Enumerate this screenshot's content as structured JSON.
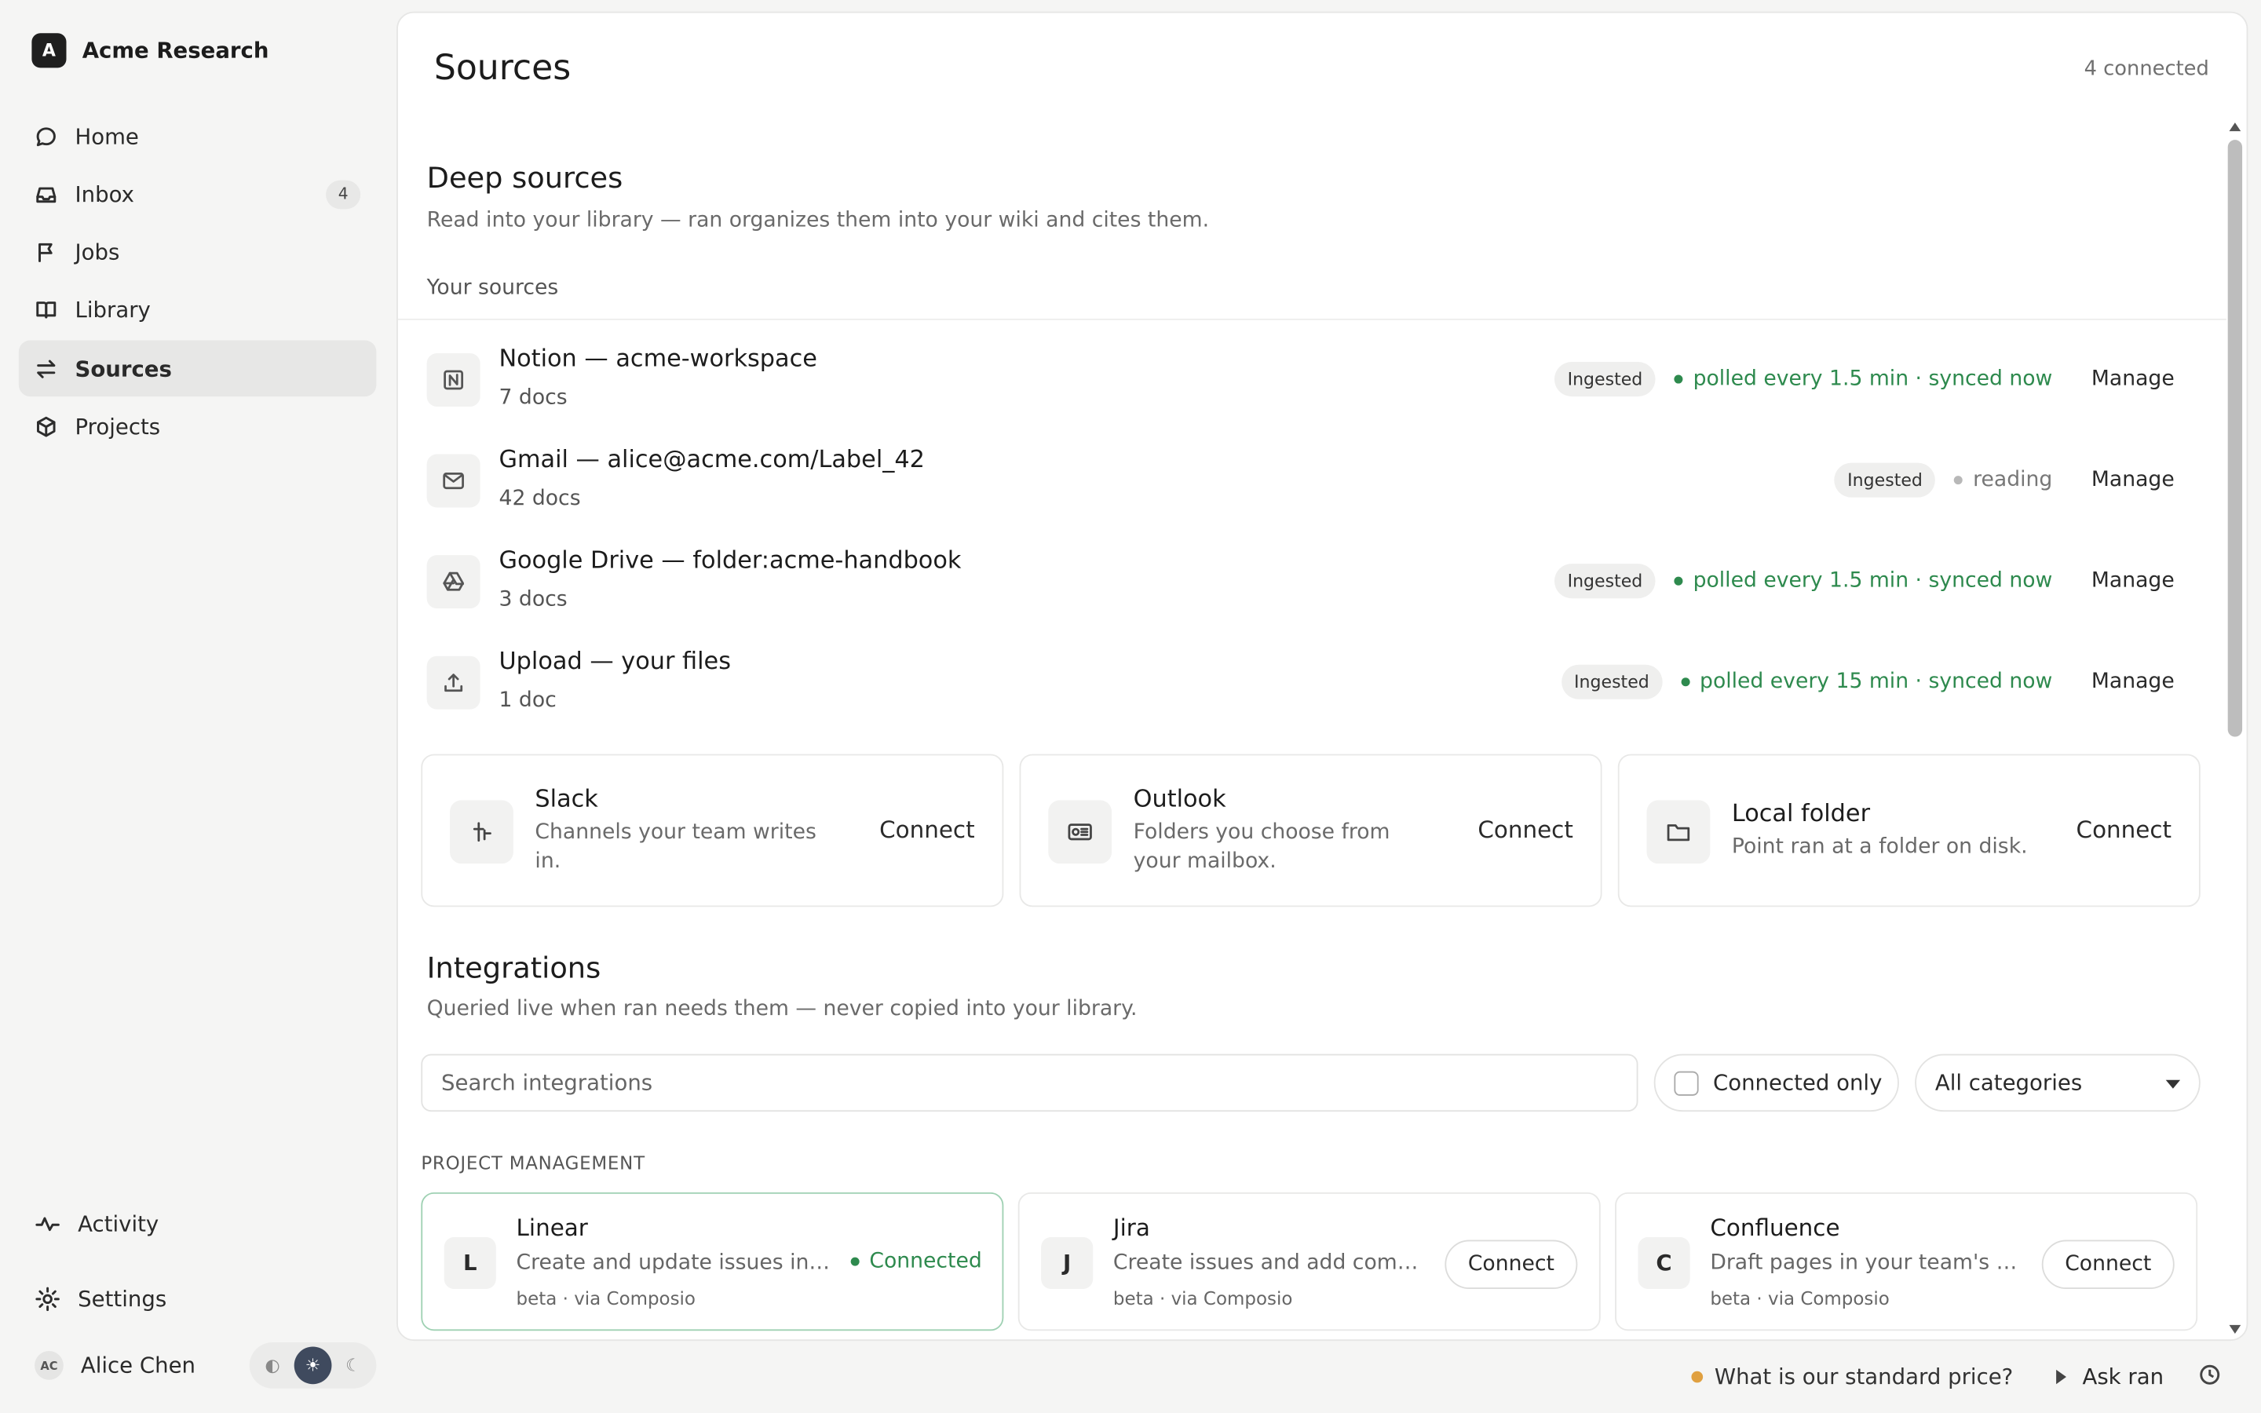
{
  "app": {
    "logo_letter": "A",
    "name": "Acme Research"
  },
  "nav": [
    {
      "label": "Home",
      "icon": "chat-bubble-icon"
    },
    {
      "label": "Inbox",
      "icon": "inbox-icon",
      "badge": "4"
    },
    {
      "label": "Jobs",
      "icon": "flag-icon"
    },
    {
      "label": "Library",
      "icon": "book-icon"
    },
    {
      "label": "Sources",
      "icon": "arrows-swap-icon",
      "active": true
    },
    {
      "label": "Projects",
      "icon": "cube-icon"
    }
  ],
  "sidebar_bottom": {
    "activity": "Activity",
    "settings": "Settings"
  },
  "user": {
    "initials": "AC",
    "name": "Alice Chen"
  },
  "theme": {
    "options": [
      "◐",
      "☀",
      "☾"
    ],
    "selected": 1
  },
  "page": {
    "title": "Sources",
    "meta": "4 connected"
  },
  "deep": {
    "title": "Deep sources",
    "subtitle": "Read into your library — ran organizes them into your wiki and cites them.",
    "your_label": "Your sources",
    "sources": [
      {
        "name": "Notion — acme-workspace",
        "docs": "7 docs",
        "pill": "Ingested",
        "status": "polled every 1.5 min · synced now",
        "state": "ok",
        "action": "Manage",
        "icon": "notion-icon"
      },
      {
        "name": "Gmail — alice@acme.com/Label_42",
        "docs": "42 docs",
        "pill": "Ingested",
        "status": "reading",
        "state": "pending",
        "action": "Manage",
        "icon": "mail-icon"
      },
      {
        "name": "Google Drive — folder:acme-handbook",
        "docs": "3 docs",
        "pill": "Ingested",
        "status": "polled every 1.5 min · synced now",
        "state": "ok",
        "action": "Manage",
        "icon": "drive-icon"
      },
      {
        "name": "Upload — your files",
        "docs": "1 doc",
        "pill": "Ingested",
        "status": "polled every 15 min · synced now",
        "state": "ok",
        "action": "Manage",
        "icon": "upload-icon"
      }
    ],
    "available": [
      {
        "title": "Slack",
        "desc": "Channels your team writes in.",
        "action": "Connect",
        "icon": "slack-icon"
      },
      {
        "title": "Outlook",
        "desc": "Folders you choose from your mailbox.",
        "action": "Connect",
        "icon": "outlook-icon"
      },
      {
        "title": "Local folder",
        "desc": "Point ran at a folder on disk.",
        "action": "Connect",
        "icon": "folder-icon"
      }
    ]
  },
  "integrations": {
    "title": "Integrations",
    "subtitle": "Queried live when ran needs them — never copied into your library.",
    "search_placeholder": "Search integrations",
    "filter_label": "Connected only",
    "category_select": "All categories",
    "category_heading": "PROJECT MANAGEMENT",
    "items": [
      {
        "letter": "L",
        "title": "Linear",
        "desc": "Create and update issues in your workspace.",
        "meta": "beta · via Composio",
        "status": "Connected",
        "connected": true
      },
      {
        "letter": "J",
        "title": "Jira",
        "desc": "Create issues and add comments to tickets.",
        "meta": "beta · via Composio",
        "status": "Connect",
        "connected": false
      },
      {
        "letter": "C",
        "title": "Confluence",
        "desc": "Draft pages in your team's Confluence spaces.",
        "meta": "beta · via Composio",
        "status": "Connect",
        "connected": false
      }
    ]
  },
  "bottom": {
    "question": "What is our standard price?",
    "ask": "Ask ran"
  }
}
